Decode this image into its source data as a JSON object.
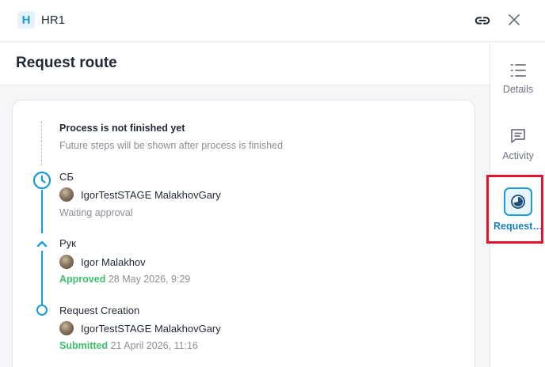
{
  "header": {
    "app_badge": "H",
    "app_name": "HR1"
  },
  "main": {
    "title": "Request route"
  },
  "timeline": {
    "pending": {
      "title": "Process is not finished yet",
      "subtitle": "Future steps will be shown after process is finished"
    },
    "steps": [
      {
        "name": "СБ",
        "user": "IgorTestSTAGE MalakhovGary",
        "status": "Waiting approval",
        "date": ""
      },
      {
        "name": "Рук",
        "user": "Igor Malakhov",
        "status": "Approved",
        "date": "28 May 2026, 9:29"
      },
      {
        "name": "Request Creation",
        "user": "IgorTestSTAGE MalakhovGary",
        "status": "Submitted",
        "date": "21 April 2026, 11:16"
      }
    ]
  },
  "sidebar": {
    "items": [
      {
        "label": "Details",
        "icon": "list-icon"
      },
      {
        "label": "Activity",
        "icon": "comment-icon"
      },
      {
        "label": "Request ...",
        "icon": "route-icon",
        "active": true
      }
    ]
  },
  "colors": {
    "accent": "#1a9bd8",
    "approved": "#3dbf6e",
    "highlight": "#e0142c"
  }
}
